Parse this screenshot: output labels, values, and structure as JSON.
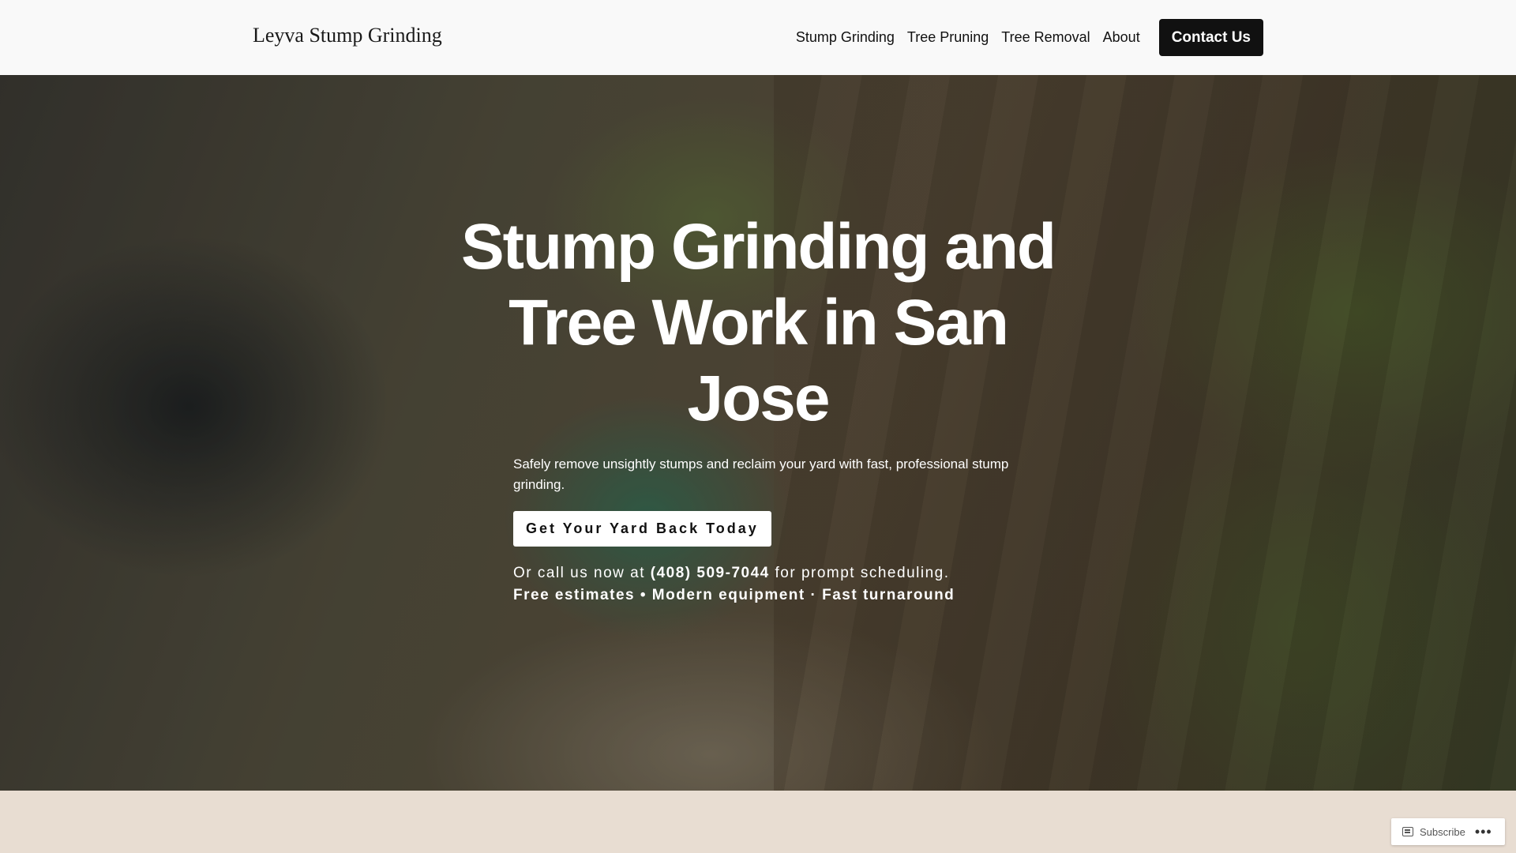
{
  "header": {
    "site_title": "Leyva Stump Grinding",
    "nav": [
      {
        "label": "Stump Grinding"
      },
      {
        "label": "Tree Pruning"
      },
      {
        "label": "Tree Removal"
      },
      {
        "label": "About"
      }
    ],
    "contact_label": "Contact Us"
  },
  "hero": {
    "title": "Stump Grinding and Tree Work in San Jose",
    "subtitle": "Safely remove unsightly stumps and reclaim your yard with fast, professional stump grinding.",
    "cta_label": "Get Your Yard Back Today",
    "call_prefix": "Or call us now at",
    "phone": "(408) 509-7044",
    "call_suffix": "for prompt scheduling.",
    "features": "Free estimates • Modern equipment · Fast turnaround"
  },
  "footer_bar": {
    "subscribe_label": "Subscribe",
    "more_label": "•••"
  },
  "colors": {
    "header_bg": "#f9f9f9",
    "button_dark": "#111111",
    "section_bg": "#e8ddd2"
  }
}
